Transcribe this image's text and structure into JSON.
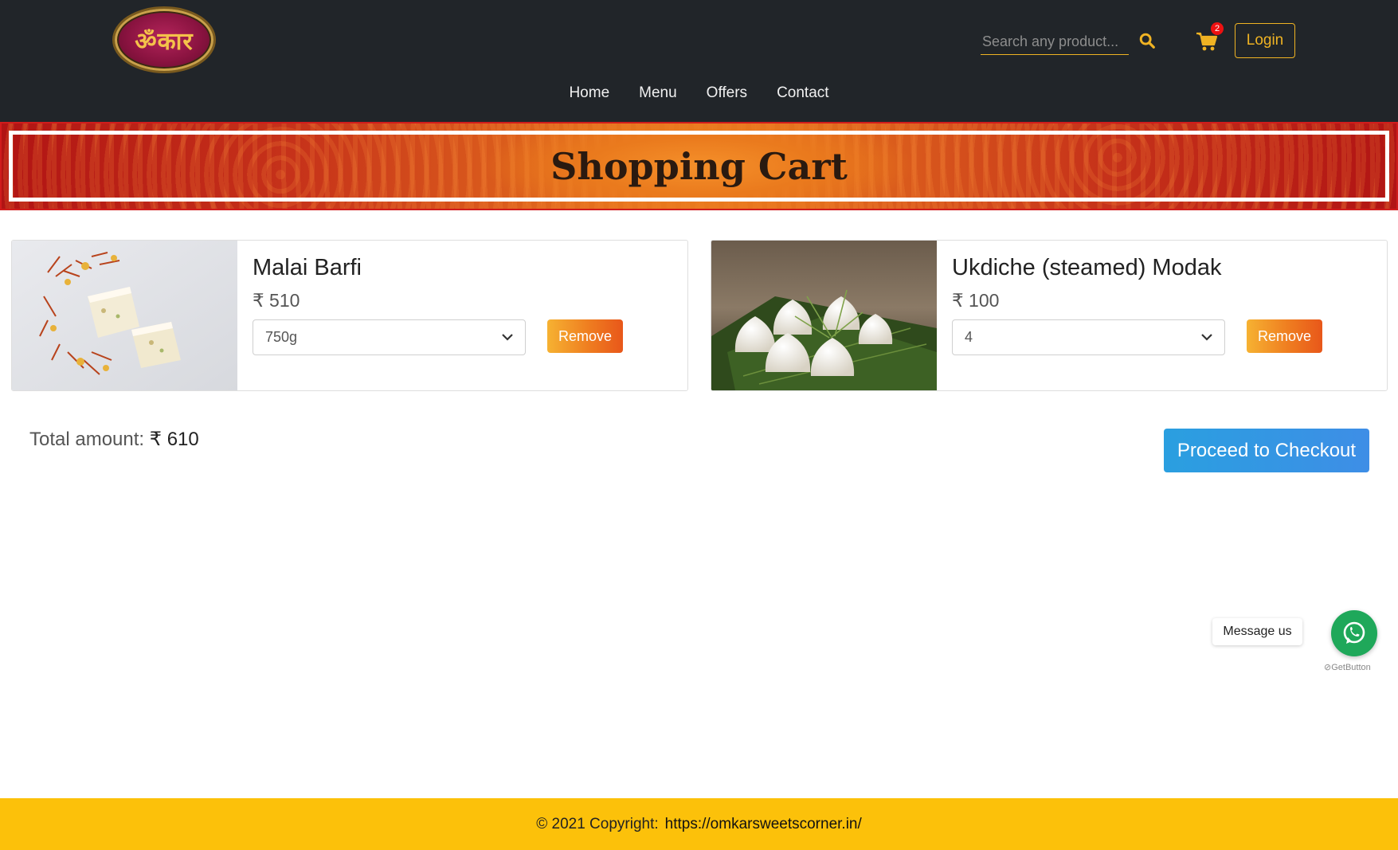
{
  "header": {
    "logo_text": "ॐकार",
    "search": {
      "placeholder": "Search any product...",
      "value": ""
    },
    "search_icon": "search-icon",
    "cart_icon": "cart-icon",
    "cart_count": "2",
    "login_label": "Login",
    "nav": [
      {
        "label": "Home"
      },
      {
        "label": "Menu"
      },
      {
        "label": "Offers"
      },
      {
        "label": "Contact"
      }
    ],
    "accent_color": "#f0b323"
  },
  "banner": {
    "title": "Shopping Cart"
  },
  "cart": {
    "items": [
      {
        "name": "Malai Barfi",
        "price": "₹ 510",
        "selected_option": "750g",
        "remove_label": "Remove"
      },
      {
        "name": "Ukdiche (steamed) Modak",
        "price": "₹ 100",
        "selected_option": "4",
        "remove_label": "Remove"
      }
    ],
    "total_label": "Total amount:",
    "total_value": "₹ 610",
    "checkout_label": "Proceed to Checkout"
  },
  "whatsapp": {
    "message_label": "Message us",
    "brand": "GetButton",
    "icon": "whatsapp-icon",
    "color": "#1fa85a"
  },
  "footer": {
    "copyright": "© 2021 Copyright:",
    "link": "https://omkarsweetscorner.in/",
    "color": "#fcc10a"
  }
}
